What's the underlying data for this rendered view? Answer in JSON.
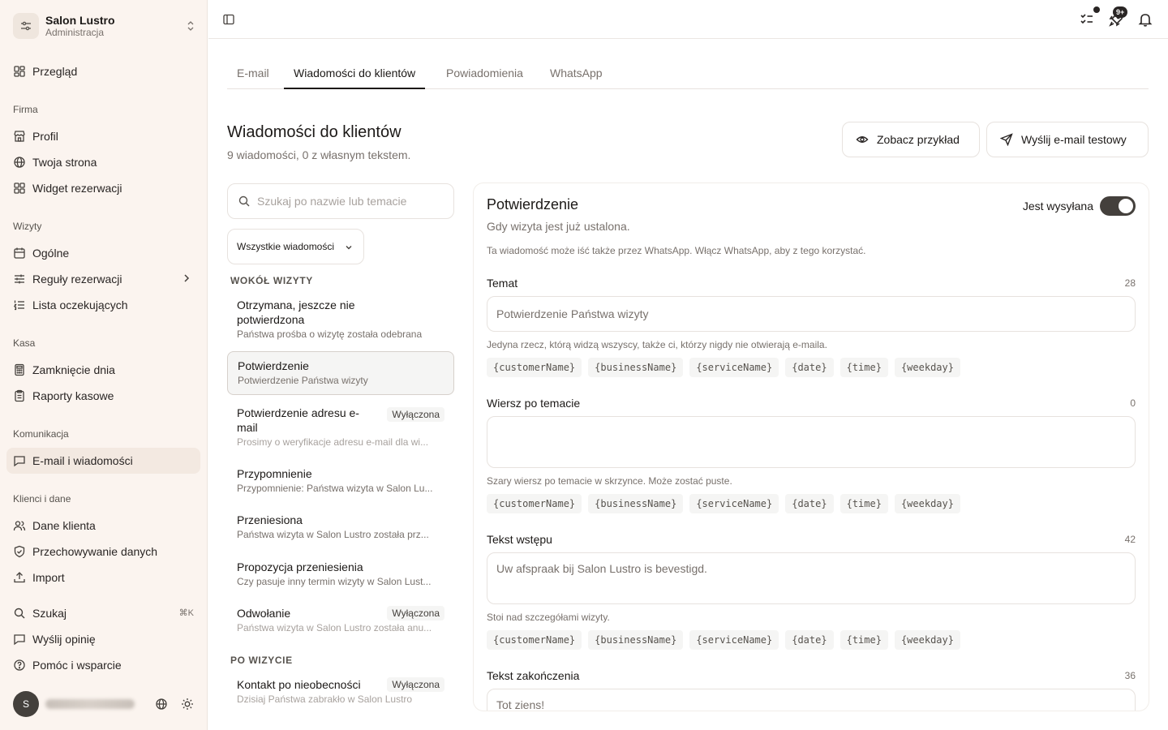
{
  "brand": {
    "name": "Salon Lustro",
    "subtitle": "Administracja"
  },
  "nav": {
    "overview": "Przegląd",
    "section_company": "Firma",
    "profile": "Profil",
    "your_site": "Twoja strona",
    "booking_widget": "Widget rezerwacji",
    "section_visits": "Wizyty",
    "general": "Ogólne",
    "booking_rules": "Reguły rezerwacji",
    "waitlist": "Lista oczekujących",
    "section_cash": "Kasa",
    "day_close": "Zamknięcie dnia",
    "cash_reports": "Raporty kasowe",
    "section_comm": "Komunikacja",
    "email_messages": "E-mail i wiadomości",
    "section_clients": "Klienci i dane",
    "client_data": "Dane klienta",
    "data_retention": "Przechowywanie danych",
    "import": "Import",
    "search": "Szukaj",
    "search_shortcut": "⌘K",
    "feedback": "Wyślij opinię",
    "help": "Pomóc i wsparcie"
  },
  "user": {
    "initial": "S"
  },
  "topbar": {
    "notifications_count": "9+"
  },
  "tabs": [
    "E-mail",
    "Wiadomości do klientów",
    "Powiadomienia",
    "WhatsApp"
  ],
  "header": {
    "title": "Wiadomości do klientów",
    "subtitle": "9 wiadomości, 0 z własnym tekstem.",
    "preview_button": "Zobacz przykład",
    "test_button": "Wyślij e-mail testowy"
  },
  "list": {
    "search_placeholder": "Szukaj po nazwie lub temacie",
    "filter_value": "Wszystkie wiadomości",
    "group_around": "WOKÓŁ WIZYTY",
    "group_after": "PO WIZYCIE",
    "disabled_label": "Wyłączona",
    "items": [
      {
        "title": "Otrzymana, jeszcze nie potwierdzona",
        "subtitle": "Państwa prośba o wizytę została odebrana"
      },
      {
        "title": "Potwierdzenie",
        "subtitle": "Potwierdzenie Państwa wizyty"
      },
      {
        "title": "Potwierdzenie adresu e-mail",
        "subtitle": "Prosimy o weryfikacje adresu e-mail dla wi..."
      },
      {
        "title": "Przypomnienie",
        "subtitle": "Przypomnienie: Państwa wizyta w Salon Lu..."
      },
      {
        "title": "Przeniesiona",
        "subtitle": "Państwa wizyta w Salon Lustro została prz..."
      },
      {
        "title": "Propozycja przeniesienia",
        "subtitle": "Czy pasuje inny termin wizyty w Salon Lust..."
      },
      {
        "title": "Odwołanie",
        "subtitle": "Państwa wizyta w Salon Lustro została anu..."
      },
      {
        "title": "Kontakt po nieobecności",
        "subtitle": "Dzisiaj Państwa zabrakło w Salon Lustro"
      }
    ]
  },
  "editor": {
    "title": "Potwierdzenie",
    "subtitle": "Gdy wizyta jest już ustalona.",
    "note": "Ta wiadomość może iść także przez WhatsApp. Włącz WhatsApp, aby z tego korzystać.",
    "toggle_label": "Jest wysyłana",
    "toggle_on": true,
    "chips": [
      "{customerName}",
      "{businessName}",
      "{serviceName}",
      "{date}",
      "{time}",
      "{weekday}"
    ],
    "fields": {
      "subject": {
        "label": "Temat",
        "count": "28",
        "placeholder": "Potwierdzenie Państwa wizyty",
        "help": "Jedyna rzecz, którą widzą wszyscy, także ci, którzy nigdy nie otwierają e-maila."
      },
      "preheader": {
        "label": "Wiersz po temacie",
        "count": "0",
        "placeholder": "",
        "help": "Szary wiersz po temacie w skrzynce. Może zostać puste."
      },
      "intro": {
        "label": "Tekst wstępu",
        "count": "42",
        "placeholder": "Uw afspraak bij Salon Lustro is bevestigd.",
        "help": "Stoi nad szczegółami wizyty."
      },
      "closing": {
        "label": "Tekst zakończenia",
        "count": "36",
        "placeholder": "Tot ziens!"
      }
    }
  }
}
